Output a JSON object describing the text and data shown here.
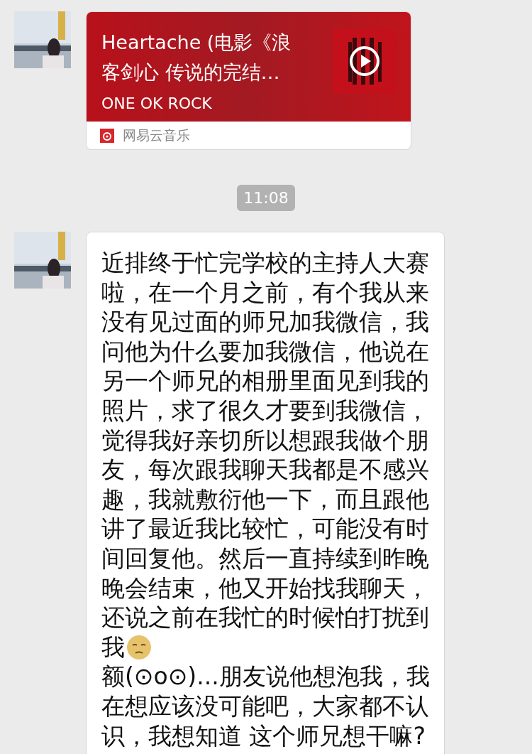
{
  "messages": [
    {
      "kind": "music",
      "title_lines": [
        "Heartache (电影《浪",
        "客剑心 传说的完结…"
      ],
      "artist": "ONE OK ROCK",
      "source": "网易云音乐"
    },
    {
      "kind": "timestamp",
      "text": "11:08"
    },
    {
      "kind": "text",
      "lines": [
        {
          "text": "近排终于忙完学校的主持人大赛",
          "emoji": false
        },
        {
          "text": "啦，在一个月之前，有个我从来",
          "emoji": false
        },
        {
          "text": "没有见过面的师兄加我微信，我",
          "emoji": false
        },
        {
          "text": "问他为什么要加我微信，他说在",
          "emoji": false
        },
        {
          "text": "另一个师兄的相册里面见到我的",
          "emoji": false
        },
        {
          "text": "照片，求了很久才要到我微信，",
          "emoji": false
        },
        {
          "text": "觉得我好亲切所以想跟我做个朋",
          "emoji": false
        },
        {
          "text": "友，每次跟我聊天我都是不感兴",
          "emoji": false
        },
        {
          "text": "趣，我就敷衍他一下，而且跟他",
          "emoji": false
        },
        {
          "text": "讲了最近我比较忙，可能没有时",
          "emoji": false
        },
        {
          "text": "间回复他。然后一直持续到昨晚",
          "emoji": false
        },
        {
          "text": "晚会结束，他又开始找我聊天，",
          "emoji": false
        },
        {
          "text": "还说之前在我忙的时候怕打扰到",
          "emoji": false
        },
        {
          "text": "我",
          "emoji": true
        },
        {
          "text": "额(⊙o⊙)...朋友说他想泡我，我",
          "emoji": false
        },
        {
          "text": "在想应该没可能吧，大家都不认",
          "emoji": false
        },
        {
          "text": "识，我想知道 这个师兄想干嘛?",
          "emoji": false
        }
      ]
    }
  ]
}
